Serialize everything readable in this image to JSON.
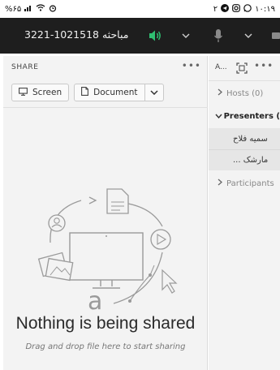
{
  "status_bar": {
    "time": "۱۰:۱۹",
    "battery": "%۶۵",
    "notification_count": "۲"
  },
  "top_bar": {
    "meeting_title": "مباحثه 1021518-3221",
    "colors": {
      "background": "#1e1e1e",
      "speaker_active": "#2fbf71"
    },
    "icons": [
      "speaker-icon",
      "microphone-icon",
      "camera-icon"
    ]
  },
  "share_pod": {
    "title": "SHARE",
    "buttons": [
      {
        "label": "Screen",
        "icon": "monitor-icon"
      },
      {
        "label": "Document",
        "icon": "document-icon"
      }
    ],
    "empty_title": "Nothing is being shared",
    "empty_subtitle": "Drag and drop file here to start sharing"
  },
  "attendees_pod": {
    "title": "A...",
    "groups": [
      {
        "label": "Hosts (0)",
        "expanded": false
      },
      {
        "label": "Presenters (",
        "expanded": true
      },
      {
        "label": "Participants",
        "expanded": false
      }
    ],
    "presenters": [
      "سمیه فلاح",
      "... مارشک"
    ]
  }
}
